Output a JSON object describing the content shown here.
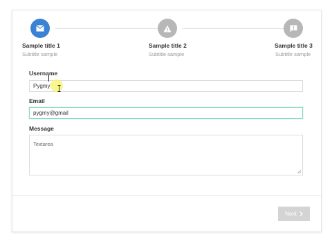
{
  "steps": [
    {
      "title": "Sample title 1",
      "subtitle": "Subtitle sample",
      "icon": "mail-icon",
      "state": "active"
    },
    {
      "title": "Sample title 2",
      "subtitle": "Subtitle sample",
      "icon": "warning-icon",
      "state": "inactive"
    },
    {
      "title": "Sample title 3",
      "subtitle": "Subtitle sample",
      "icon": "message-alert-icon",
      "state": "inactive"
    }
  ],
  "form": {
    "username_label": "Username",
    "username_value": "Pygmy",
    "email_label": "Email",
    "email_value": "pygmy@gmail",
    "message_label": "Message",
    "message_placeholder": "Textarea"
  },
  "footer": {
    "next_label": "Next"
  },
  "colors": {
    "active_step": "#3b82d4",
    "inactive_step": "#b7b7b7",
    "focus_border": "#8fd8c9",
    "button_disabled": "#d4d4d4"
  }
}
